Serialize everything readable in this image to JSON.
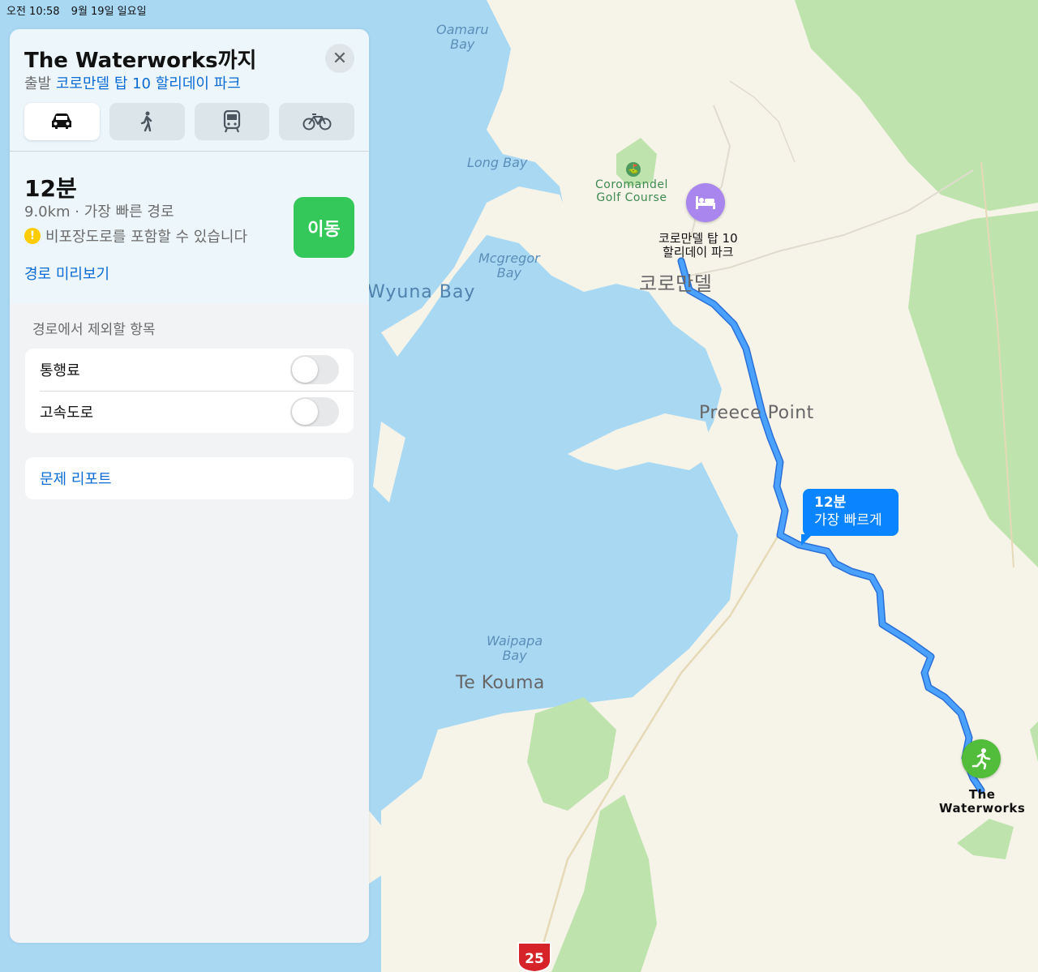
{
  "status_bar": {
    "time": "오전 10:58",
    "date": "9월 19일 일요일"
  },
  "panel": {
    "title": "The Waterworks까지",
    "subtitle_prefix": "출발",
    "origin": "코로만델 탑 10 할리데이 파크",
    "transport_modes": [
      {
        "name": "car-icon",
        "active": true
      },
      {
        "name": "walk-icon",
        "active": false
      },
      {
        "name": "transit-icon",
        "active": false
      },
      {
        "name": "bicycle-icon",
        "active": false
      }
    ],
    "route": {
      "eta": "12분",
      "summary": "9.0km · 가장 빠른 경로",
      "warning": "비포장도로를 포함할 수 있습니다",
      "preview_link": "경로 미리보기",
      "go_label": "이동"
    },
    "avoid": {
      "heading": "경로에서 제외할 항목",
      "options": [
        {
          "label": "통행료",
          "enabled": false
        },
        {
          "label": "고속도로",
          "enabled": false
        }
      ]
    },
    "report_label": "문제 리포트"
  },
  "map": {
    "labels": {
      "oamaru_bay": "Oamaru\nBay",
      "long_bay": "Long Bay",
      "mcgregor_bay": "Mcgregor\nBay",
      "wyuna_bay": "Wyuna Bay",
      "waipapa_bay": "Waipapa\nBay",
      "te_kouma": "Te Kouma",
      "preece_point": "Preece Point",
      "coromandel_town": "코로만델",
      "golf_course": "Coromandel\nGolf Course",
      "origin_poi": "코로만델 탑 10\n할리데이 파크",
      "destination_poi": "The\nWaterworks"
    },
    "callout": {
      "time": "12분",
      "desc": "가장 빠르게"
    },
    "highway_shield": "25",
    "colors": {
      "water": "#a9d8f3",
      "land": "#f6f3e9",
      "park": "#bfe3ad",
      "route": "#3a8ff0",
      "origin_pin": "#a985ee",
      "destination_pin": "#52bd3a"
    }
  }
}
